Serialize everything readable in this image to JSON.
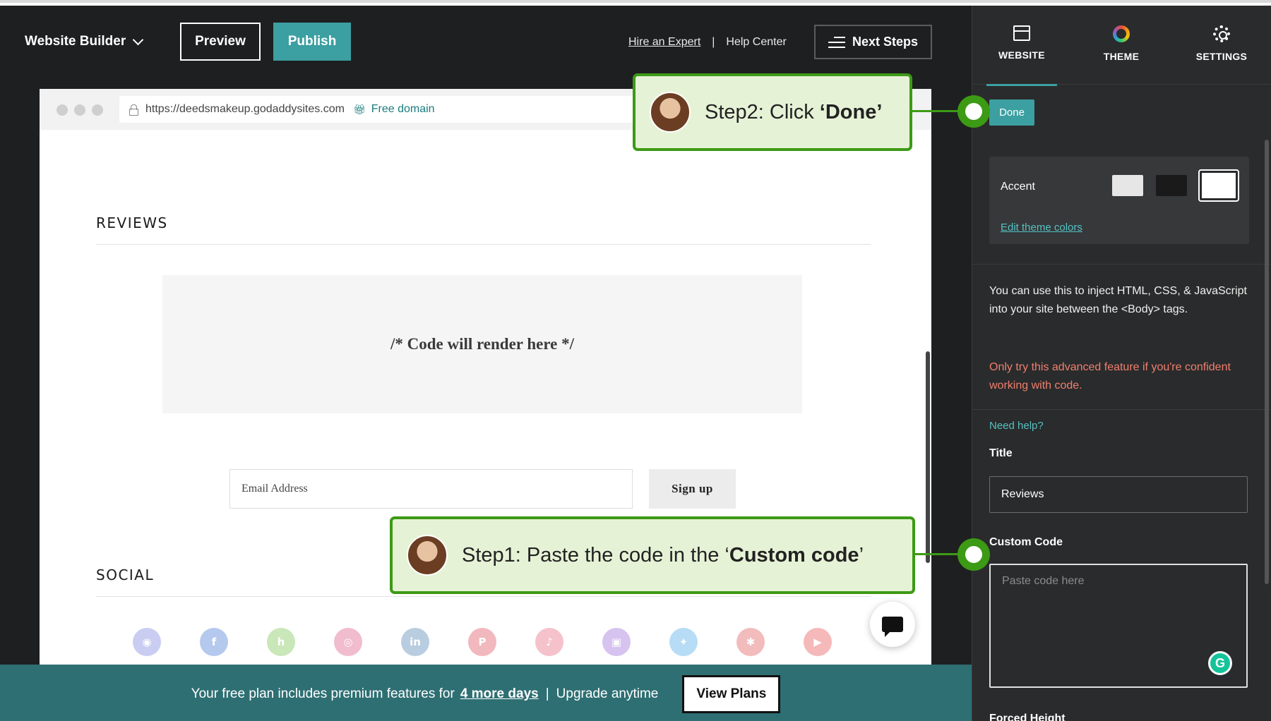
{
  "topbar": {
    "brand": "Website Builder",
    "preview": "Preview",
    "publish": "Publish",
    "hire": "Hire an Expert",
    "divider": "|",
    "help": "Help Center",
    "next_steps": "Next Steps"
  },
  "browser": {
    "url": "https://deedsmakeup.godaddysites.com",
    "free_domain": "Free domain"
  },
  "site": {
    "reviews_title": "REVIEWS",
    "code_placeholder": "/* Code will render here */",
    "email_placeholder": "Email Address",
    "signup": "Sign up",
    "social_title": "SOCIAL",
    "social_icons": [
      {
        "name": "discord-icon",
        "glyph": "◉",
        "color": "#c9cdf2"
      },
      {
        "name": "facebook-icon",
        "glyph": "f",
        "color": "#b5c9ee"
      },
      {
        "name": "houzz-icon",
        "glyph": "h",
        "color": "#c9e7b8"
      },
      {
        "name": "instagram-icon",
        "glyph": "◎",
        "color": "#f1bccd"
      },
      {
        "name": "linkedin-icon",
        "glyph": "in",
        "color": "#b9cde0"
      },
      {
        "name": "pinterest-icon",
        "glyph": "P",
        "color": "#f1b8bd"
      },
      {
        "name": "tiktok-icon",
        "glyph": "♪",
        "color": "#f5c2cb"
      },
      {
        "name": "twitch-icon",
        "glyph": "▣",
        "color": "#d6c3ef"
      },
      {
        "name": "twitter-icon",
        "glyph": "✦",
        "color": "#b7dcf5"
      },
      {
        "name": "yelp-icon",
        "glyph": "✱",
        "color": "#f2bcbc"
      },
      {
        "name": "youtube-icon",
        "glyph": "▶",
        "color": "#f5b9b9"
      }
    ]
  },
  "banner": {
    "text": "Your free plan includes premium features for",
    "days": "4 more days",
    "sep": "|",
    "upgrade": "Upgrade anytime",
    "view_plans": "View Plans"
  },
  "panel": {
    "tabs": [
      {
        "label": "WEBSITE"
      },
      {
        "label": "THEME"
      },
      {
        "label": "SETTINGS"
      }
    ],
    "done": "Done",
    "accent_label": "Accent",
    "accent_swatches": [
      "#e6e6e6",
      "#1a1a1a",
      "#ffffff"
    ],
    "edit_theme": "Edit theme colors",
    "description": "You can use this to inject HTML, CSS, & JavaScript into your site between the <Body> tags.",
    "warning": "Only try this advanced feature if you're confident working with code.",
    "need_help": "Need help?",
    "title_label": "Title",
    "title_value": "Reviews",
    "custom_code_label": "Custom Code",
    "custom_code_placeholder": "Paste code here",
    "grammarly": "G",
    "forced_height_label": "Forced Height"
  },
  "callouts": {
    "step2_prefix": "Step2: Click ",
    "step2_bold": "‘Done’",
    "step1_prefix": "Step1: Paste the code in the ‘",
    "step1_bold": "Custom code",
    "step1_suffix": "’"
  },
  "colors": {
    "accent_teal": "#3c9fa1",
    "callout_green": "#3c9a15",
    "callout_bg": "#e6f2d6",
    "banner_bg": "#2e6f73"
  }
}
